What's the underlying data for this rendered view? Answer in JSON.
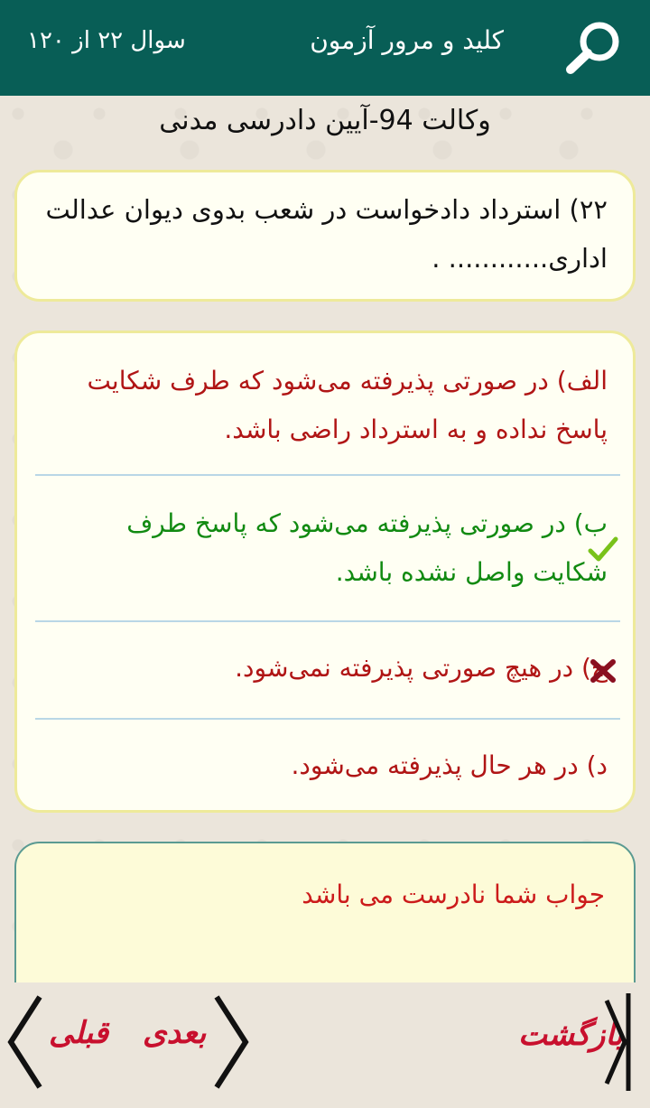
{
  "header": {
    "title": "کلید و مرور آزمون",
    "counter": "سوال ۲۲ از ۱۲۰",
    "search_icon": "search-icon"
  },
  "quiz": {
    "title": "وکالت 94-آیین دادرسی مدنی"
  },
  "question": {
    "text": "۲۲) استرداد دادخواست در شعب بدوی دیوان عدالت اداری............ ."
  },
  "options": [
    {
      "text": "الف) در صورتی پذیرفته می‌شود که طرف شکایت پاسخ نداده و به استرداد راضی باشد.",
      "color": "#b01515",
      "mark": ""
    },
    {
      "text": "ب) در صورتی پذیرفته می‌شود که پاسخ طرف شکایت واصل نشده باشد.",
      "color": "#118a11",
      "mark": "check-icon"
    },
    {
      "text": "ج) در هیچ صورتی پذیرفته نمی‌شود.",
      "color": "#b01515",
      "mark": "cross-icon"
    },
    {
      "text": "د) در هر حال پذیرفته می‌شود.",
      "color": "#b01515",
      "mark": ""
    }
  ],
  "feedback": {
    "text": "جواب شما نادرست می باشد"
  },
  "footer": {
    "back_label": "بازگشت",
    "next_label": "بعدی",
    "prev_label": "قبلی"
  },
  "colors": {
    "appbar": "#085e56",
    "correct": "#118a11",
    "wrong": "#b01515",
    "nav_label": "#c8102e"
  }
}
